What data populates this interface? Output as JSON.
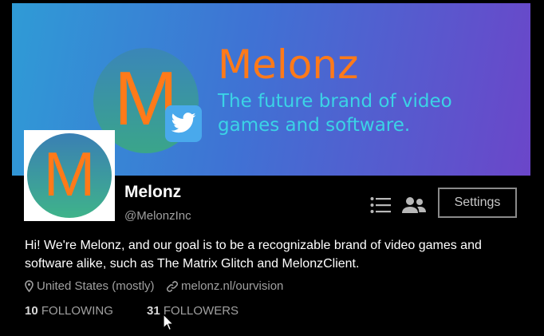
{
  "banner": {
    "logo_letter": "M",
    "title": "Melonz",
    "tagline": "The future brand of video games and software.",
    "colors": {
      "gradient_start": "#2f9bd6",
      "gradient_end": "#6b46c9",
      "title": "#ff7a19",
      "tagline": "#3bd3e6"
    },
    "badge_icon": "twitter-bird-icon"
  },
  "profile": {
    "avatar_letter": "M",
    "name": "Melonz",
    "handle": "@MelonzInc",
    "bio": "Hi! We're Melonz, and our goal is to be a recognizable brand of video games and software alike, such as The Matrix Glitch and MelonzClient.",
    "location": "United States (mostly)",
    "website": "melonz.nl/ourvision"
  },
  "stats": {
    "following_count": "10",
    "following_label": "FOLLOWING",
    "followers_count": "31",
    "followers_label": "FOLLOWERS"
  },
  "actions": {
    "lists_icon": "list-icon",
    "people_icon": "people-icon",
    "settings_label": "Settings"
  }
}
